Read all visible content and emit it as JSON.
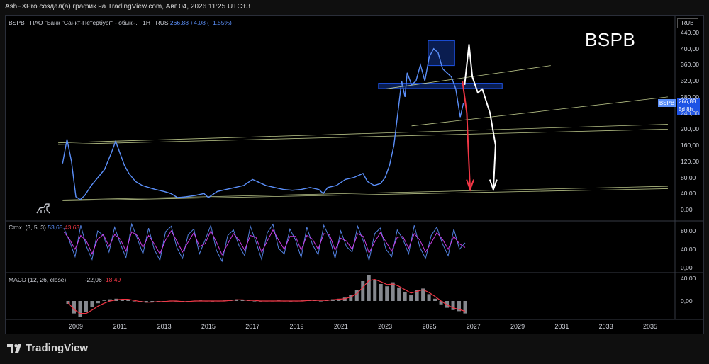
{
  "header": {
    "caption": "AshFXPro создал(а) график на TradingView.com, Авг 04, 2026 11:25 UTC+3"
  },
  "symbol": {
    "ticker": "BSPB",
    "legend": "BSPB · ПАО \"Банк \"Санкт-Петербург\" - обыкн. · 1H · RUS",
    "last": "266,88",
    "change": "+4,08 (+1,55%)",
    "countdown": "5d 8h"
  },
  "watermark": "BSPB",
  "currency": "RUB",
  "stoch": {
    "label": "Стох. (3, 5, 3)",
    "k": "53,65",
    "d": "43,63"
  },
  "macd": {
    "label": "MACD (12, 26, close)",
    "hist": "-22,06",
    "signal": "-18,49"
  },
  "brand": "TradingView",
  "colors": {
    "price": "#5b8ff9",
    "stoch_k": "#5b8ff9",
    "stoch_d": "#e040fb",
    "macd_signal": "#f23645",
    "annotation_red": "#f23645",
    "annotation_white": "#ffffff",
    "trendline": "#d9e6a0",
    "zone": "#1e53e5"
  },
  "chart_data": [
    {
      "type": "line",
      "title": "BSPB",
      "series": [
        {
          "name": "BSPB",
          "x": [
            2008.4,
            2008.6,
            2008.8,
            2009.0,
            2009.2,
            2009.4,
            2009.7,
            2010.0,
            2010.3,
            2010.6,
            2010.8,
            2011.0,
            2011.2,
            2011.4,
            2011.7,
            2012.0,
            2012.3,
            2012.6,
            2013.0,
            2013.3,
            2013.6,
            2014.0,
            2014.4,
            2014.8,
            2015.0,
            2015.4,
            2015.8,
            2016.2,
            2016.6,
            2017.0,
            2017.2,
            2017.6,
            2018.0,
            2018.4,
            2018.8,
            2019.2,
            2019.6,
            2020.0,
            2020.2,
            2020.4,
            2020.8,
            2021.2,
            2021.6,
            2022.0,
            2022.2,
            2022.5,
            2022.8,
            2023.0,
            2023.2,
            2023.4,
            2023.6,
            2023.75,
            2023.9,
            2024.0,
            2024.2,
            2024.4,
            2024.6,
            2024.8,
            2025.0,
            2025.2,
            2025.4,
            2025.6,
            2025.8,
            2026.0,
            2026.2,
            2026.4,
            2026.55
          ],
          "y": [
            115,
            175,
            120,
            32,
            25,
            35,
            60,
            80,
            100,
            140,
            170,
            140,
            110,
            90,
            70,
            60,
            55,
            50,
            45,
            40,
            30,
            32,
            35,
            40,
            30,
            45,
            50,
            55,
            60,
            75,
            70,
            60,
            55,
            50,
            48,
            50,
            55,
            50,
            40,
            55,
            60,
            75,
            80,
            90,
            70,
            60,
            65,
            80,
            110,
            160,
            250,
            320,
            280,
            340,
            310,
            320,
            360,
            320,
            380,
            400,
            390,
            350,
            340,
            330,
            300,
            230,
            265
          ]
        }
      ],
      "ylim": [
        -20,
        460
      ],
      "ticks": [
        "440,00",
        "400,00",
        "360,00",
        "320,00",
        "280,00",
        "240,00",
        "200,00",
        "160,00",
        "120,00",
        "80,00",
        "40,00",
        "0,00"
      ],
      "xticks": [
        "2009",
        "2011",
        "2013",
        "2015",
        "2017",
        "2019",
        "2021",
        "2023",
        "2025",
        "2027",
        "2029",
        "2031",
        "2033",
        "2035"
      ],
      "trendlines": [
        {
          "x": [
            2023.0,
            2030.5
          ],
          "y": [
            300,
            358
          ]
        },
        {
          "x": [
            2024.2,
            2035.8
          ],
          "y": [
            208,
            280
          ]
        },
        {
          "x": [
            2008.2,
            2035.8
          ],
          "y": [
            166,
            212
          ]
        },
        {
          "x": [
            2008.2,
            2035.8
          ],
          "y": [
            162,
            200
          ]
        },
        {
          "x": [
            2008.4,
            2035.8
          ],
          "y": [
            24,
            58
          ]
        },
        {
          "x": [
            2008.4,
            2035.8
          ],
          "y": [
            22,
            52
          ]
        }
      ],
      "zones": [
        {
          "x": [
            2022.7,
            2028.3
          ],
          "y": [
            301,
            314
          ]
        },
        {
          "x": [
            2024.95,
            2026.15
          ],
          "y": [
            358,
            420
          ]
        }
      ],
      "annotations": [
        {
          "color": "red",
          "path_x": [
            2026.5,
            2026.7,
            2026.75,
            2026.85
          ],
          "path_y": [
            320,
            240,
            170,
            50
          ]
        },
        {
          "color": "white",
          "path_x": [
            2026.6,
            2026.8,
            2026.95,
            2027.2,
            2027.4,
            2027.75,
            2028.0,
            2027.9
          ],
          "path_y": [
            310,
            410,
            330,
            290,
            300,
            240,
            160,
            50
          ]
        }
      ]
    },
    {
      "type": "line",
      "title": "Стох. (3, 5, 3)",
      "ylim": [
        0,
        100
      ],
      "ticks": [
        "80,00",
        "40,00",
        "0,00"
      ],
      "series": [
        {
          "name": "53,65",
          "values": [
            86,
            58,
            24,
            92,
            46,
            18,
            80,
            70,
            34,
            88,
            52,
            22,
            95,
            64,
            30,
            86,
            40,
            16,
            78,
            90,
            44,
            20,
            72,
            84,
            30,
            60,
            92,
            38,
            14,
            70,
            82,
            48,
            26,
            90,
            56,
            18,
            76,
            94,
            42,
            30,
            84,
            60,
            22,
            88,
            50,
            28,
            92,
            66,
            20,
            80,
            46,
            34,
            90,
            58,
            16,
            74,
            86,
            40,
            24,
            82,
            62,
            30,
            92,
            44,
            20,
            70,
            88,
            52,
            26,
            84,
            40,
            54
          ]
        },
        {
          "name": "43,63",
          "values": [
            78,
            62,
            40,
            70,
            58,
            30,
            62,
            72,
            46,
            72,
            62,
            36,
            78,
            70,
            44,
            70,
            52,
            30,
            60,
            80,
            58,
            34,
            56,
            76,
            46,
            52,
            80,
            56,
            28,
            52,
            74,
            60,
            38,
            70,
            66,
            34,
            58,
            82,
            60,
            40,
            68,
            68,
            38,
            70,
            62,
            40,
            74,
            72,
            38,
            64,
            58,
            40,
            74,
            68,
            32,
            56,
            76,
            56,
            36,
            66,
            68,
            42,
            74,
            60,
            34,
            54,
            76,
            62,
            40,
            68,
            52,
            44
          ]
        }
      ]
    },
    {
      "type": "bar",
      "title": "MACD (12, 26, close)",
      "ylim": [
        -30,
        50
      ],
      "ticks": [
        "40,00",
        "0,00"
      ],
      "series": [
        {
          "name": "-22,06",
          "values": [
            -5,
            -22,
            -28,
            -20,
            -10,
            -4,
            1,
            3,
            4,
            3,
            2,
            0,
            -2,
            -3,
            -2,
            -1,
            0,
            0,
            -1,
            -2,
            -1,
            0,
            1,
            0,
            -1,
            0,
            1,
            2,
            3,
            2,
            1,
            0,
            -1,
            0,
            0,
            1,
            0,
            -1,
            0,
            1,
            2,
            1,
            0,
            1,
            3,
            4,
            6,
            10,
            20,
            35,
            46,
            38,
            30,
            26,
            33,
            24,
            16,
            10,
            20,
            22,
            12,
            4,
            -6,
            -12,
            -16,
            -18,
            -22
          ]
        },
        {
          "name": "-18,49",
          "values": [
            -3,
            -15,
            -22,
            -22,
            -16,
            -9,
            -4,
            0,
            2,
            3,
            3,
            1,
            -1,
            -2,
            -2,
            -1,
            -1,
            0,
            0,
            -1,
            -1,
            0,
            0,
            0,
            0,
            0,
            0,
            1,
            2,
            2,
            1,
            1,
            0,
            0,
            0,
            0,
            0,
            0,
            0,
            0,
            1,
            1,
            1,
            1,
            2,
            3,
            4,
            7,
            13,
            24,
            36,
            38,
            34,
            29,
            30,
            26,
            20,
            14,
            17,
            20,
            15,
            8,
            0,
            -7,
            -12,
            -15,
            -18
          ]
        }
      ]
    }
  ]
}
